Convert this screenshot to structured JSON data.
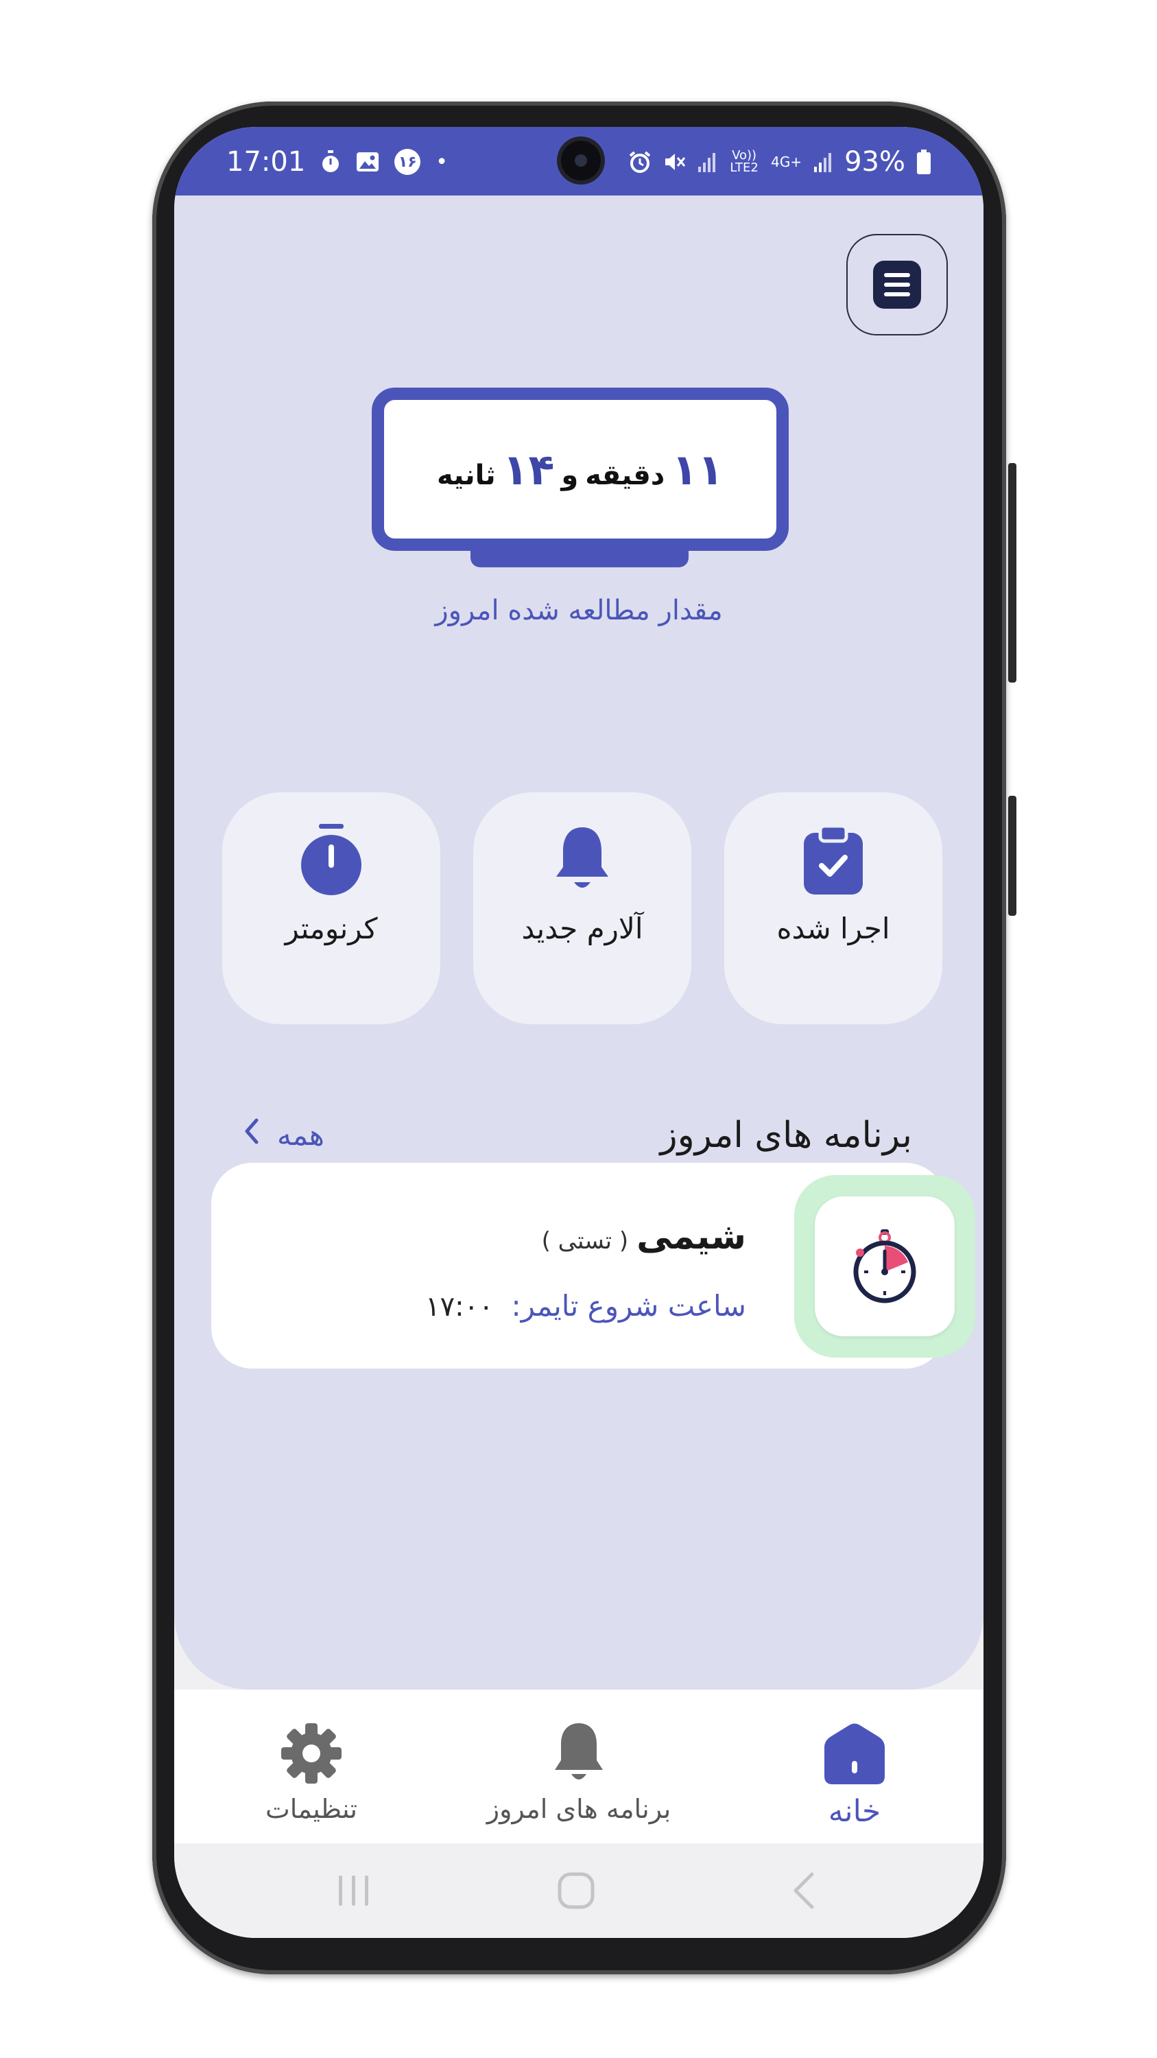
{
  "status_bar": {
    "time": "17:01",
    "notification_badge": "۱۶",
    "dot": "•",
    "network_volte": "Vo)) LTE2",
    "network_4g": "4G+",
    "battery": "93%",
    "background": "#4b55b9"
  },
  "menu": {
    "icon": "menu-icon"
  },
  "timer": {
    "minutes_value": "۱۱",
    "minutes_unit": "دقیقه",
    "conjunction": "و",
    "seconds_value": "۱۴",
    "seconds_unit": "ثانیه",
    "caption": "مقدار مطالعه شده امروز"
  },
  "quick_actions": [
    {
      "label": "اجرا شده",
      "icon": "clipboard-check-icon"
    },
    {
      "label": "آلارم جدید",
      "icon": "bell-icon"
    },
    {
      "label": "کرنومتر",
      "icon": "stopwatch-icon"
    }
  ],
  "today_section": {
    "title": "برنامه های امروز",
    "see_all": "همه",
    "see_all_icon": "chevron-left-icon"
  },
  "task": {
    "name": "شیمی",
    "tag": "( تستی )",
    "start_label": "ساعت شروع تایمر:",
    "start_time": "۱۷:۰۰",
    "icon": "timer-icon",
    "icon_bg": "#ccf1d4"
  },
  "bottom_nav": [
    {
      "label": "خانه",
      "icon": "home-icon",
      "active": true
    },
    {
      "label": "برنامه های امروز",
      "icon": "bell-icon",
      "active": false
    },
    {
      "label": "تنظیمات",
      "icon": "gear-icon",
      "active": false
    }
  ],
  "system_nav": [
    "recents-icon",
    "home-circle-icon",
    "back-icon"
  ],
  "colors": {
    "accent": "#4b55b9",
    "main_bg": "#dcdeef",
    "tile_bg": "#eff0f7",
    "dark_icon": "#1e2447"
  }
}
